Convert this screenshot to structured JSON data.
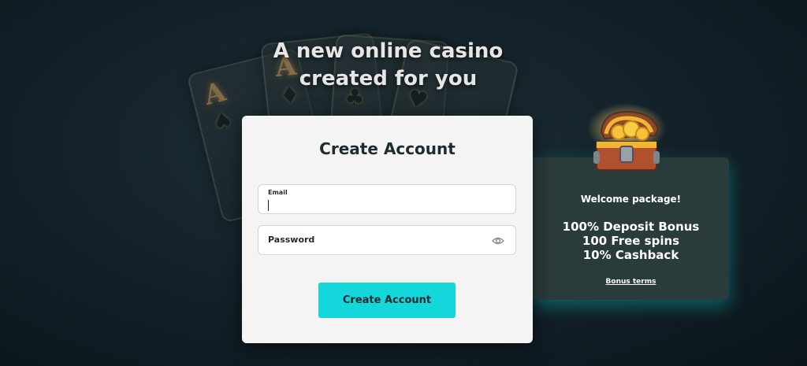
{
  "headline": {
    "line1": "A new online casino",
    "line2": "created for you"
  },
  "decor_cards": [
    {
      "rank": "A",
      "suit": "♠"
    },
    {
      "rank": "A",
      "suit": "♦"
    },
    {
      "rank": "",
      "suit": "♣"
    },
    {
      "rank": "",
      "suit": "♥"
    }
  ],
  "form": {
    "title": "Create Account",
    "email": {
      "label": "Email",
      "value": ""
    },
    "password": {
      "label": "Password",
      "value": ""
    },
    "submit_label": "Create Account",
    "icons": {
      "password_toggle": "eye-icon"
    }
  },
  "promo": {
    "title": "Welcome package!",
    "offers": [
      "100% Deposit Bonus",
      "100 Free spins",
      "10% Cashback"
    ],
    "terms_link": "Bonus terms",
    "image": "treasure-chest-icon"
  },
  "colors": {
    "accent": "#14d7dc",
    "background": "#14222a",
    "promo_bg": "#2a3b3c"
  }
}
